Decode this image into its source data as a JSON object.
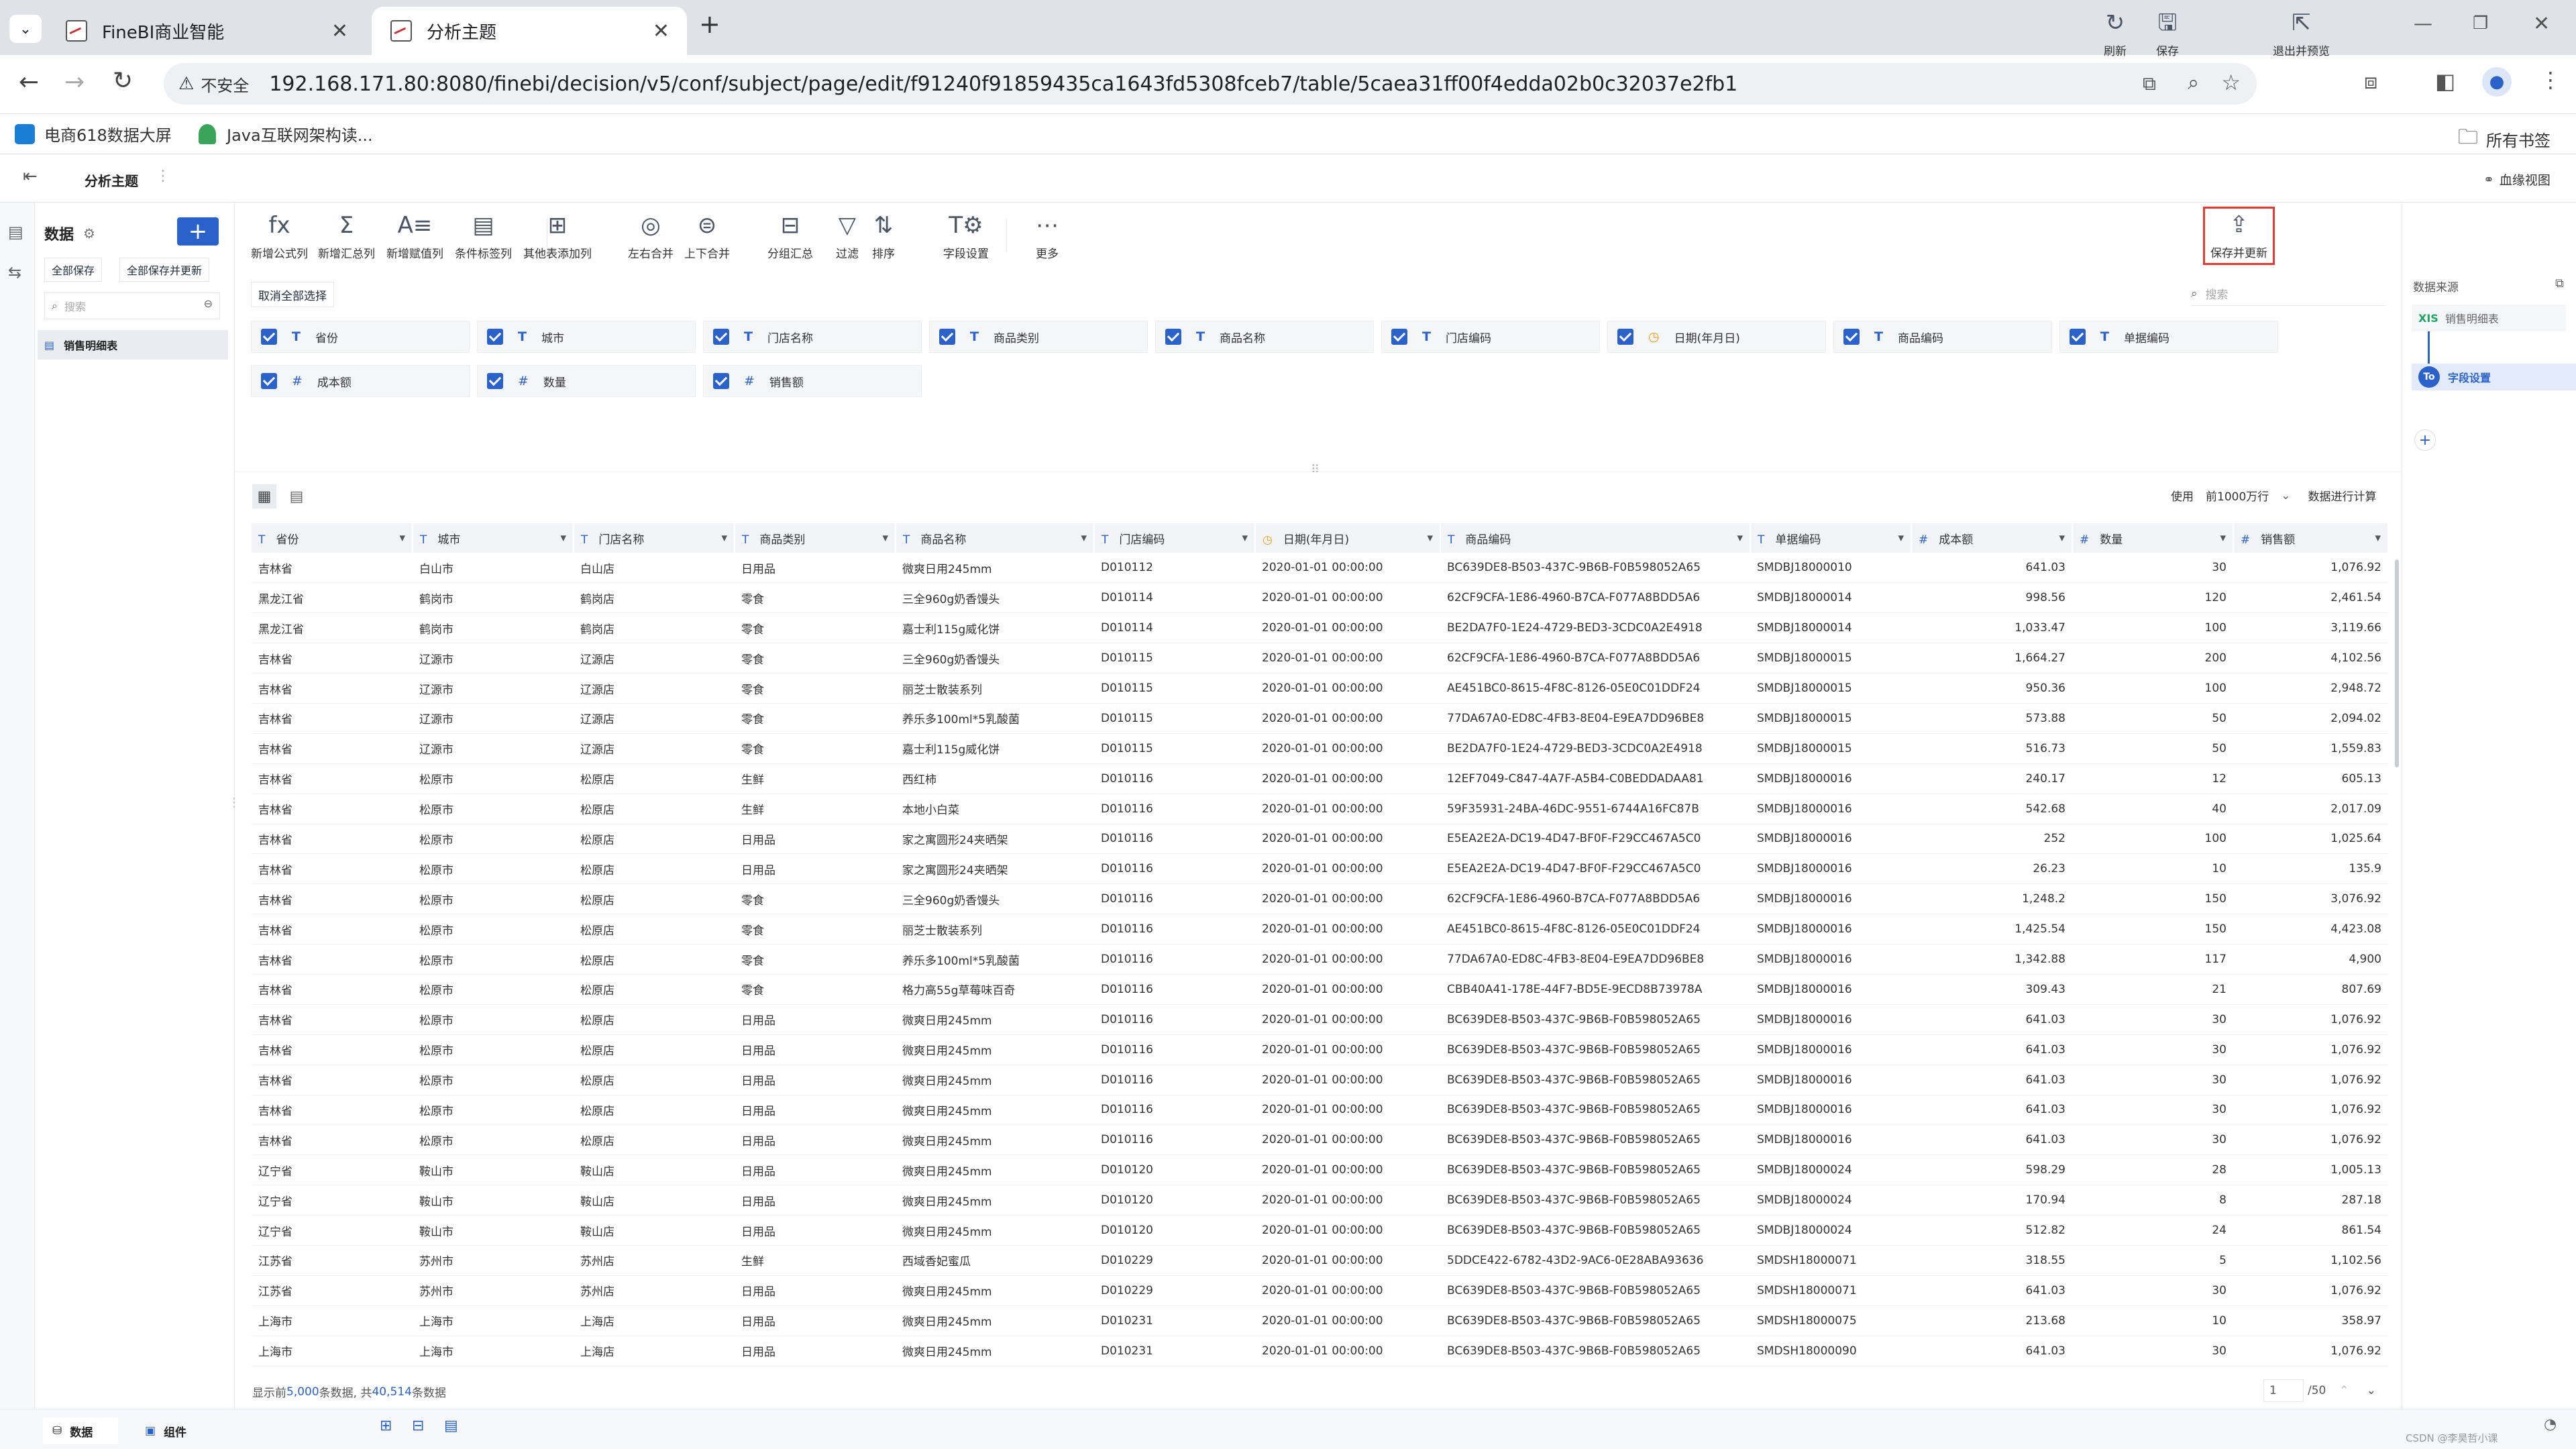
{
  "browser": {
    "tabs": [
      {
        "title": "FineBI商业智能",
        "active": false
      },
      {
        "title": "分析主题",
        "active": true
      }
    ],
    "security_label": "不安全",
    "url": "192.168.171.80:8080/finebi/decision/v5/conf/subject/page/edit/f91240f91859435ca1643fd5308fceb7/table/5caea31ff00f4edda02b0c32037e2fb1",
    "bookmarks": [
      "电商618数据大屏",
      "Java互联网架构读..."
    ],
    "all_bookmarks": "所有书签"
  },
  "app": {
    "title": "分析主题",
    "lineage": "血缘视图"
  },
  "left_panel": {
    "title": "数据",
    "add": "+",
    "save_all": "全部保存",
    "save_all_update": "全部保存并更新",
    "search_placeholder": "搜索",
    "tables": [
      "销售明细表"
    ]
  },
  "ribbon": {
    "tools": [
      "新增公式列",
      "新增汇总列",
      "新增赋值列",
      "条件标签列",
      "其他表添加列",
      "左右合并",
      "上下合并",
      "分组汇总",
      "过滤",
      "排序",
      "字段设置",
      "更多"
    ],
    "icons": [
      "fx",
      "Σ",
      "A≡",
      "▤",
      "⊞",
      "◎",
      "⊜",
      "⊟",
      "▽",
      "⇅",
      "T⚙",
      "⋯"
    ],
    "right_tools": [
      "刷新",
      "保存",
      "保存并更新",
      "退出并预览"
    ]
  },
  "field_panel": {
    "deselect_all": "取消全部选择",
    "search_placeholder": "搜索",
    "fields": [
      {
        "name": "省份",
        "type": "T"
      },
      {
        "name": "城市",
        "type": "T"
      },
      {
        "name": "门店名称",
        "type": "T"
      },
      {
        "name": "商品类别",
        "type": "T"
      },
      {
        "name": "商品名称",
        "type": "T"
      },
      {
        "name": "门店编码",
        "type": "T"
      },
      {
        "name": "日期(年月日)",
        "type": "date"
      },
      {
        "name": "商品编码",
        "type": "T"
      },
      {
        "name": "单据编码",
        "type": "T"
      },
      {
        "name": "成本额",
        "type": "#"
      },
      {
        "name": "数量",
        "type": "#"
      },
      {
        "name": "销售额",
        "type": "#"
      }
    ]
  },
  "table_toolbar": {
    "use_label": "使用",
    "row_limit": "前1000万行",
    "compute_label": "数据进行计算"
  },
  "table": {
    "columns": [
      "省份",
      "城市",
      "门店名称",
      "商品类别",
      "商品名称",
      "门店编码",
      "日期(年月日)",
      "商品编码",
      "单据编码",
      "成本额",
      "数量",
      "销售额"
    ],
    "column_types": [
      "T",
      "T",
      "T",
      "T",
      "T",
      "T",
      "date",
      "T",
      "T",
      "#",
      "#",
      "#"
    ],
    "rows": [
      [
        "吉林省",
        "白山市",
        "白山店",
        "日用品",
        "微爽日用245mm",
        "D010112",
        "2020-01-01 00:00:00",
        "BC639DE8-B503-437C-9B6B-F0B598052A65",
        "SMDBJ18000010",
        "641.03",
        "30",
        "1,076.92"
      ],
      [
        "黑龙江省",
        "鹤岗市",
        "鹤岗店",
        "零食",
        "三全960g奶香馒头",
        "D010114",
        "2020-01-01 00:00:00",
        "62CF9CFA-1E86-4960-B7CA-F077A8BDD5A6",
        "SMDBJ18000014",
        "998.56",
        "120",
        "2,461.54"
      ],
      [
        "黑龙江省",
        "鹤岗市",
        "鹤岗店",
        "零食",
        "嘉士利115g威化饼",
        "D010114",
        "2020-01-01 00:00:00",
        "BE2DA7F0-1E24-4729-BED3-3CDC0A2E4918",
        "SMDBJ18000014",
        "1,033.47",
        "100",
        "3,119.66"
      ],
      [
        "吉林省",
        "辽源市",
        "辽源店",
        "零食",
        "三全960g奶香馒头",
        "D010115",
        "2020-01-01 00:00:00",
        "62CF9CFA-1E86-4960-B7CA-F077A8BDD5A6",
        "SMDBJ18000015",
        "1,664.27",
        "200",
        "4,102.56"
      ],
      [
        "吉林省",
        "辽源市",
        "辽源店",
        "零食",
        "丽芝士散装系列",
        "D010115",
        "2020-01-01 00:00:00",
        "AE451BC0-8615-4F8C-8126-05E0C01DDF24",
        "SMDBJ18000015",
        "950.36",
        "100",
        "2,948.72"
      ],
      [
        "吉林省",
        "辽源市",
        "辽源店",
        "零食",
        "养乐多100ml*5乳酸菌",
        "D010115",
        "2020-01-01 00:00:00",
        "77DA67A0-ED8C-4FB3-8E04-E9EA7DD96BE8",
        "SMDBJ18000015",
        "573.88",
        "50",
        "2,094.02"
      ],
      [
        "吉林省",
        "辽源市",
        "辽源店",
        "零食",
        "嘉士利115g威化饼",
        "D010115",
        "2020-01-01 00:00:00",
        "BE2DA7F0-1E24-4729-BED3-3CDC0A2E4918",
        "SMDBJ18000015",
        "516.73",
        "50",
        "1,559.83"
      ],
      [
        "吉林省",
        "松原市",
        "松原店",
        "生鲜",
        "西红柿",
        "D010116",
        "2020-01-01 00:00:00",
        "12EF7049-C847-4A7F-A5B4-C0BEDDADAA81",
        "SMDBJ18000016",
        "240.17",
        "12",
        "605.13"
      ],
      [
        "吉林省",
        "松原市",
        "松原店",
        "生鲜",
        "本地小白菜",
        "D010116",
        "2020-01-01 00:00:00",
        "59F35931-24BA-46DC-9551-6744A16FC87B",
        "SMDBJ18000016",
        "542.68",
        "40",
        "2,017.09"
      ],
      [
        "吉林省",
        "松原市",
        "松原店",
        "日用品",
        "家之寓圆形24夹晒架",
        "D010116",
        "2020-01-01 00:00:00",
        "E5EA2E2A-DC19-4D47-BF0F-F29CC467A5C0",
        "SMDBJ18000016",
        "252",
        "100",
        "1,025.64"
      ],
      [
        "吉林省",
        "松原市",
        "松原店",
        "日用品",
        "家之寓圆形24夹晒架",
        "D010116",
        "2020-01-01 00:00:00",
        "E5EA2E2A-DC19-4D47-BF0F-F29CC467A5C0",
        "SMDBJ18000016",
        "26.23",
        "10",
        "135.9"
      ],
      [
        "吉林省",
        "松原市",
        "松原店",
        "零食",
        "三全960g奶香馒头",
        "D010116",
        "2020-01-01 00:00:00",
        "62CF9CFA-1E86-4960-B7CA-F077A8BDD5A6",
        "SMDBJ18000016",
        "1,248.2",
        "150",
        "3,076.92"
      ],
      [
        "吉林省",
        "松原市",
        "松原店",
        "零食",
        "丽芝士散装系列",
        "D010116",
        "2020-01-01 00:00:00",
        "AE451BC0-8615-4F8C-8126-05E0C01DDF24",
        "SMDBJ18000016",
        "1,425.54",
        "150",
        "4,423.08"
      ],
      [
        "吉林省",
        "松原市",
        "松原店",
        "零食",
        "养乐多100ml*5乳酸菌",
        "D010116",
        "2020-01-01 00:00:00",
        "77DA67A0-ED8C-4FB3-8E04-E9EA7DD96BE8",
        "SMDBJ18000016",
        "1,342.88",
        "117",
        "4,900"
      ],
      [
        "吉林省",
        "松原市",
        "松原店",
        "零食",
        "格力高55g草莓味百奇",
        "D010116",
        "2020-01-01 00:00:00",
        "CBB40A41-178E-44F7-BD5E-9ECD8B73978A",
        "SMDBJ18000016",
        "309.43",
        "21",
        "807.69"
      ],
      [
        "吉林省",
        "松原市",
        "松原店",
        "日用品",
        "微爽日用245mm",
        "D010116",
        "2020-01-01 00:00:00",
        "BC639DE8-B503-437C-9B6B-F0B598052A65",
        "SMDBJ18000016",
        "641.03",
        "30",
        "1,076.92"
      ],
      [
        "吉林省",
        "松原市",
        "松原店",
        "日用品",
        "微爽日用245mm",
        "D010116",
        "2020-01-01 00:00:00",
        "BC639DE8-B503-437C-9B6B-F0B598052A65",
        "SMDBJ18000016",
        "641.03",
        "30",
        "1,076.92"
      ],
      [
        "吉林省",
        "松原市",
        "松原店",
        "日用品",
        "微爽日用245mm",
        "D010116",
        "2020-01-01 00:00:00",
        "BC639DE8-B503-437C-9B6B-F0B598052A65",
        "SMDBJ18000016",
        "641.03",
        "30",
        "1,076.92"
      ],
      [
        "吉林省",
        "松原市",
        "松原店",
        "日用品",
        "微爽日用245mm",
        "D010116",
        "2020-01-01 00:00:00",
        "BC639DE8-B503-437C-9B6B-F0B598052A65",
        "SMDBJ18000016",
        "641.03",
        "30",
        "1,076.92"
      ],
      [
        "吉林省",
        "松原市",
        "松原店",
        "日用品",
        "微爽日用245mm",
        "D010116",
        "2020-01-01 00:00:00",
        "BC639DE8-B503-437C-9B6B-F0B598052A65",
        "SMDBJ18000016",
        "641.03",
        "30",
        "1,076.92"
      ],
      [
        "辽宁省",
        "鞍山市",
        "鞍山店",
        "日用品",
        "微爽日用245mm",
        "D010120",
        "2020-01-01 00:00:00",
        "BC639DE8-B503-437C-9B6B-F0B598052A65",
        "SMDBJ18000024",
        "598.29",
        "28",
        "1,005.13"
      ],
      [
        "辽宁省",
        "鞍山市",
        "鞍山店",
        "日用品",
        "微爽日用245mm",
        "D010120",
        "2020-01-01 00:00:00",
        "BC639DE8-B503-437C-9B6B-F0B598052A65",
        "SMDBJ18000024",
        "170.94",
        "8",
        "287.18"
      ],
      [
        "辽宁省",
        "鞍山市",
        "鞍山店",
        "日用品",
        "微爽日用245mm",
        "D010120",
        "2020-01-01 00:00:00",
        "BC639DE8-B503-437C-9B6B-F0B598052A65",
        "SMDBJ18000024",
        "512.82",
        "24",
        "861.54"
      ],
      [
        "江苏省",
        "苏州市",
        "苏州店",
        "生鲜",
        "西域香妃蜜瓜",
        "D010229",
        "2020-01-01 00:00:00",
        "5DDCE422-6782-43D2-9AC6-0E28ABA93636",
        "SMDSH18000071",
        "318.55",
        "5",
        "1,102.56"
      ],
      [
        "江苏省",
        "苏州市",
        "苏州店",
        "日用品",
        "微爽日用245mm",
        "D010229",
        "2020-01-01 00:00:00",
        "BC639DE8-B503-437C-9B6B-F0B598052A65",
        "SMDSH18000071",
        "641.03",
        "30",
        "1,076.92"
      ],
      [
        "上海市",
        "上海市",
        "上海店",
        "日用品",
        "微爽日用245mm",
        "D010231",
        "2020-01-01 00:00:00",
        "BC639DE8-B503-437C-9B6B-F0B598052A65",
        "SMDSH18000075",
        "213.68",
        "10",
        "358.97"
      ],
      [
        "上海市",
        "上海市",
        "上海店",
        "日用品",
        "微爽日用245mm",
        "D010231",
        "2020-01-01 00:00:00",
        "BC639DE8-B503-437C-9B6B-F0B598052A65",
        "SMDSH18000090",
        "641.03",
        "30",
        "1,076.92"
      ]
    ]
  },
  "footer": {
    "prefix": "显示前",
    "shown": "5,000",
    "middle": "条数据, 共",
    "total": "40,514",
    "suffix": "条数据",
    "page_input": "1",
    "page_total": "/50"
  },
  "bottom_tabs": [
    "数据",
    "组件"
  ],
  "right_panel": {
    "title": "数据来源",
    "source_badge": "XIS",
    "source_name": "销售明细表",
    "step_badge": "To",
    "step_name": "字段设置",
    "add": "+"
  },
  "watermark": "CSDN @李昊哲小课",
  "colors": {
    "accent": "#2a62c9",
    "date": "#f0a020",
    "highlight": "#e53935"
  }
}
